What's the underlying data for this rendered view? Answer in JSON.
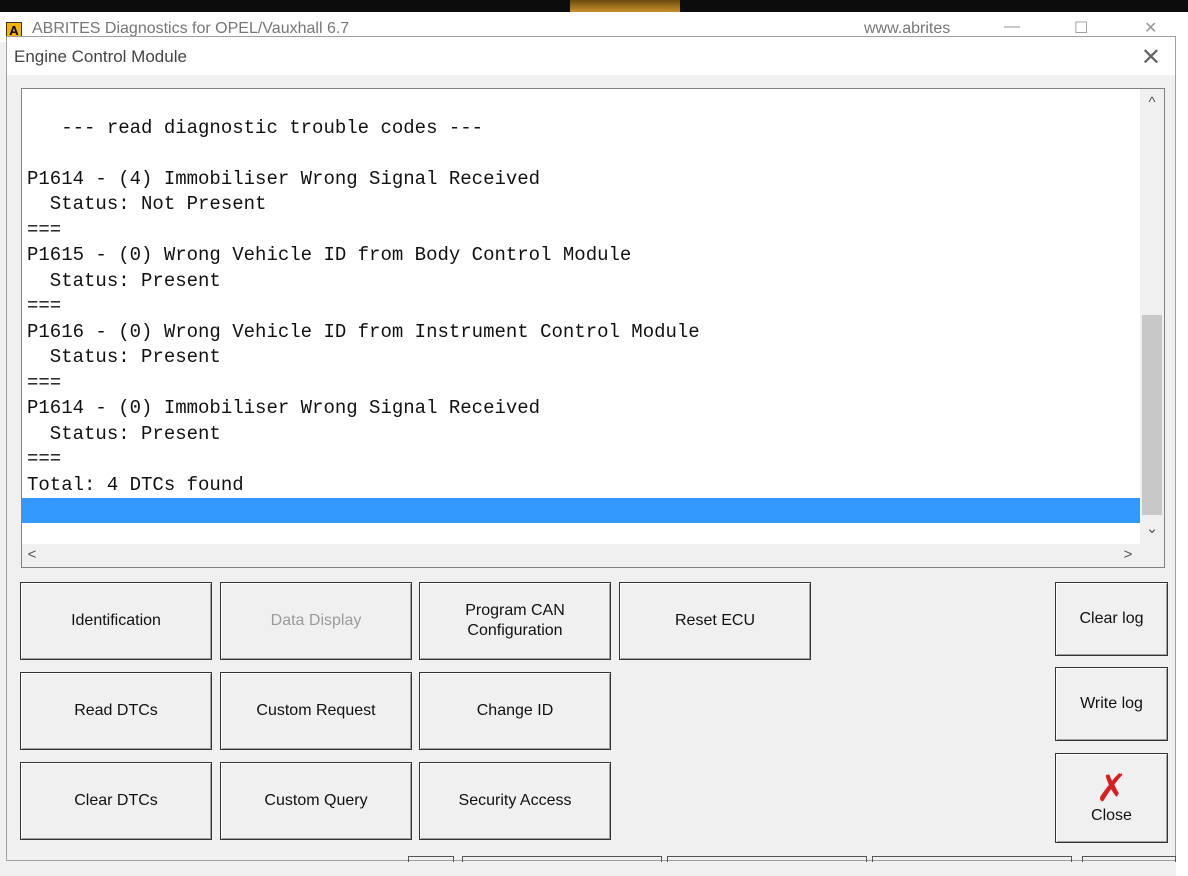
{
  "parent_window": {
    "logo_letter": "A",
    "title": "ABRITES Diagnostics for OPEL/Vauxhall 6.7",
    "url": "www.abrites",
    "minimize_icon": "minimize-icon",
    "maximize_icon": "maximize-icon",
    "close_icon": "close-icon"
  },
  "dialog": {
    "title": "Engine Control Module",
    "close_glyph": "✕"
  },
  "log": {
    "lines": [
      "   --- read diagnostic trouble codes ---",
      "",
      "P1614 - (4) Immobiliser Wrong Signal Received",
      "  Status: Not Present",
      "===",
      "P1615 - (0) Wrong Vehicle ID from Body Control Module",
      "  Status: Present",
      "===",
      "P1616 - (0) Wrong Vehicle ID from Instrument Control Module",
      "  Status: Present",
      "===",
      "P1614 - (0) Immobiliser Wrong Signal Received",
      "  Status: Present",
      "===",
      "Total: 4 DTCs found"
    ],
    "selection_color": "#3399ff"
  },
  "scrollbars": {
    "up": "^",
    "down": "⌄",
    "left": "<",
    "right": ">"
  },
  "buttons": {
    "identification": "Identification",
    "data_display": "Data Display",
    "program_can_line1": "Program CAN",
    "program_can_line2": "Configuration",
    "reset_ecu": "Reset ECU",
    "read_dtcs": "Read DTCs",
    "custom_request": "Custom Request",
    "change_id": "Change ID",
    "clear_dtcs": "Clear DTCs",
    "custom_query": "Custom Query",
    "security_access": "Security Access",
    "clear_log": "Clear log",
    "write_log": "Write log",
    "close": "Close",
    "close_icon": "✗"
  },
  "colors": {
    "close_icon": "#d42020",
    "logo": "#f4b400"
  }
}
